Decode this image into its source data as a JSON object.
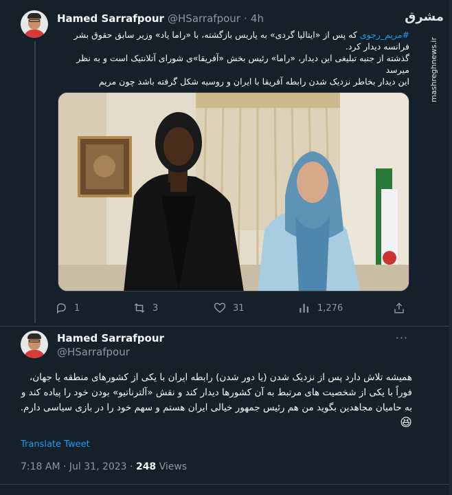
{
  "tweet1": {
    "author_name": "Hamed Sarrafpour",
    "author_handle": "@HSarrafpour",
    "separator": "·",
    "time": "4h",
    "more": "···",
    "line1_hashtag": "#مریم_رجوی",
    "line1_rest": " که پس از «ایتالیا گردی» به پاریس بازگشته، با «راما یاد» وزیر سابق حقوق بشر",
    "line2": "فرانسه دیدار کرد.",
    "line3": "گذشته از جنبه تبلیغی این دیدار، «راما» رئیس بخش «آفریقا»ی شورای آتلانتیک است و به نظر میرسد",
    "line4": "این دیدار بخاطر نزدیک شدن رابطه آفریقا با ایران و روسیه شکل گرفته باشد چون مریم",
    "actions": {
      "reply_icon": "reply-icon",
      "reply_count": "1",
      "retweet_icon": "retweet-icon",
      "retweet_count": "3",
      "like_icon": "heart-icon",
      "like_count": "31",
      "views_icon": "views-chart-icon",
      "views_count": "1,276",
      "share_icon": "share-icon"
    }
  },
  "tweet2": {
    "author_name": "Hamed Sarrafpour",
    "author_handle": "@HSarrafpour",
    "more": "···",
    "line1": "همیشه تلاش دارد پس از نزدیک شدن (یا دور شدن) رابطه ایران با یکی از کشورهای منطقه یا جهان،",
    "line2": "فوراً با یکی از شخصیت های مرتبط به آن کشورها دیدار کند و نقش «آلترناتیو» بودن خود را پیاده کند و",
    "line3": "به حامیان مجاهدین بگوید من هم رئیس جمهور خیالی ایران هستم و سهم خود را در بازی سیاسی دارم.",
    "emoji": "😆",
    "translate": "Translate Tweet",
    "time": "7:18 AM",
    "dot1": "·",
    "date": "Jul 31, 2023",
    "dot2": "·",
    "views_count": "248",
    "views_label": "Views"
  },
  "watermark": {
    "logo": "مشرق",
    "url": "mashreghnews.ir"
  },
  "colors": {
    "background": "#15202b",
    "accent": "#1d9bf0",
    "muted": "#8b98a5",
    "divider": "#38444d"
  }
}
